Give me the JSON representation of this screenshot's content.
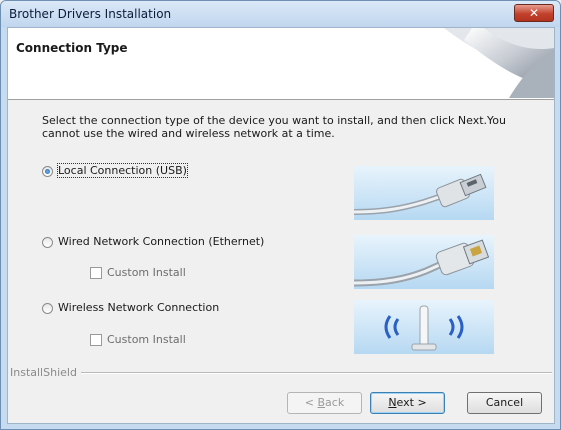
{
  "window": {
    "title": "Brother Drivers Installation",
    "close_glyph": "✕"
  },
  "header": {
    "title": "Connection Type"
  },
  "instruction": "Select the connection type of the device you want to install, and then click Next.You cannot use the wired and wireless network at a time.",
  "options": [
    {
      "label": "Local Connection (USB)",
      "selected": true,
      "icon": "usb-cable-image"
    },
    {
      "label": "Wired Network Connection (Ethernet)",
      "selected": false,
      "icon": "ethernet-cable-image",
      "custom_install": "Custom Install"
    },
    {
      "label": "Wireless Network Connection",
      "selected": false,
      "icon": "wireless-signal-image",
      "custom_install": "Custom Install"
    }
  ],
  "footer": {
    "brand": "InstallShield",
    "back_label_pre": "< ",
    "back_label_key": "B",
    "back_label_post": "ack",
    "next_label_key": "N",
    "next_label_post": "ext >",
    "cancel_label": "Cancel"
  },
  "colors": {
    "accent": "#3c7fb1",
    "close": "#c2422e"
  }
}
